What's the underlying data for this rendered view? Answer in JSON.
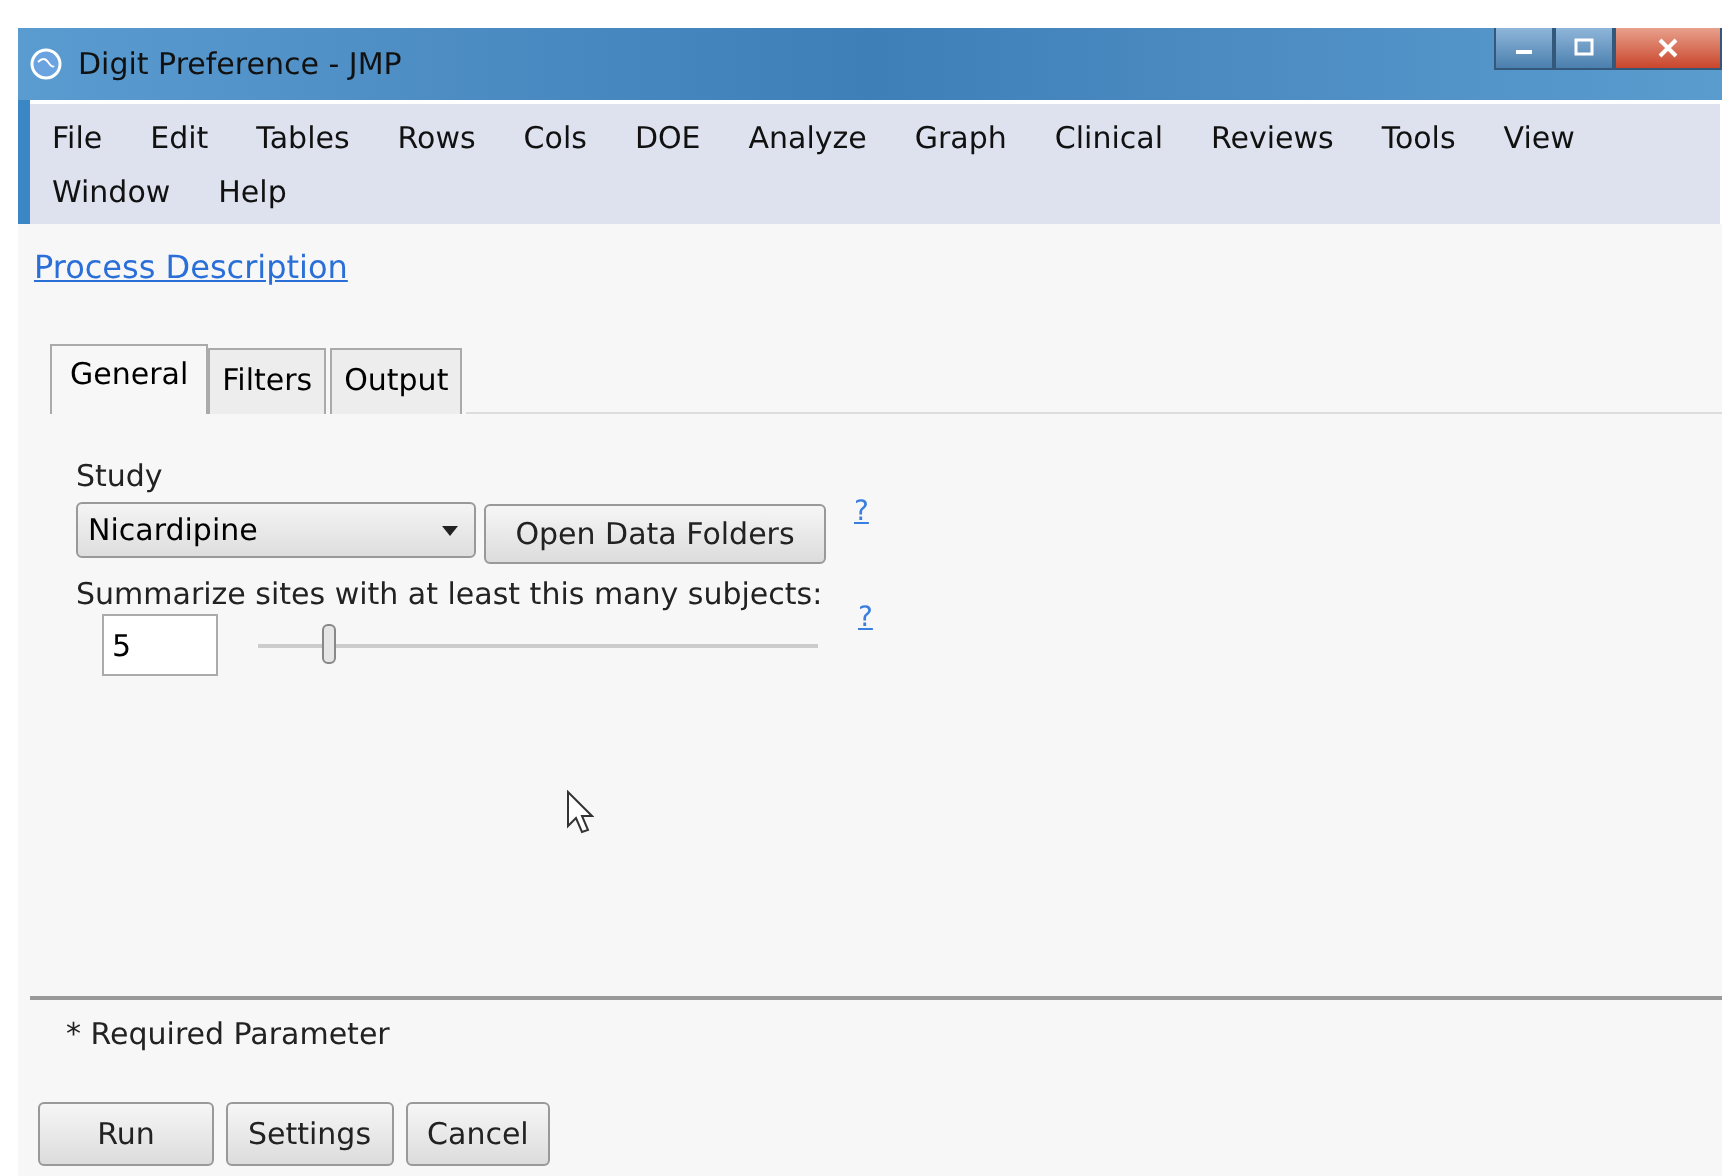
{
  "window": {
    "title": "Digit Preference - JMP"
  },
  "menu": [
    "File",
    "Edit",
    "Tables",
    "Rows",
    "Cols",
    "DOE",
    "Analyze",
    "Graph",
    "Clinical",
    "Reviews",
    "Tools",
    "View",
    "Window",
    "Help"
  ],
  "link": "Process Description",
  "tabs": [
    {
      "label": "General",
      "selected": true
    },
    {
      "label": "Filters",
      "selected": false
    },
    {
      "label": "Output",
      "selected": false
    }
  ],
  "study": {
    "label": "Study",
    "value": "Nicardipine",
    "button": "Open Data Folders",
    "help": "?"
  },
  "subjects": {
    "label": "Summarize sites with at least this many subjects:",
    "value": "5",
    "level": 0.13,
    "help": "?"
  },
  "footnote": "* Required Parameter",
  "buttons": [
    "Run",
    "Settings",
    "Cancel"
  ]
}
